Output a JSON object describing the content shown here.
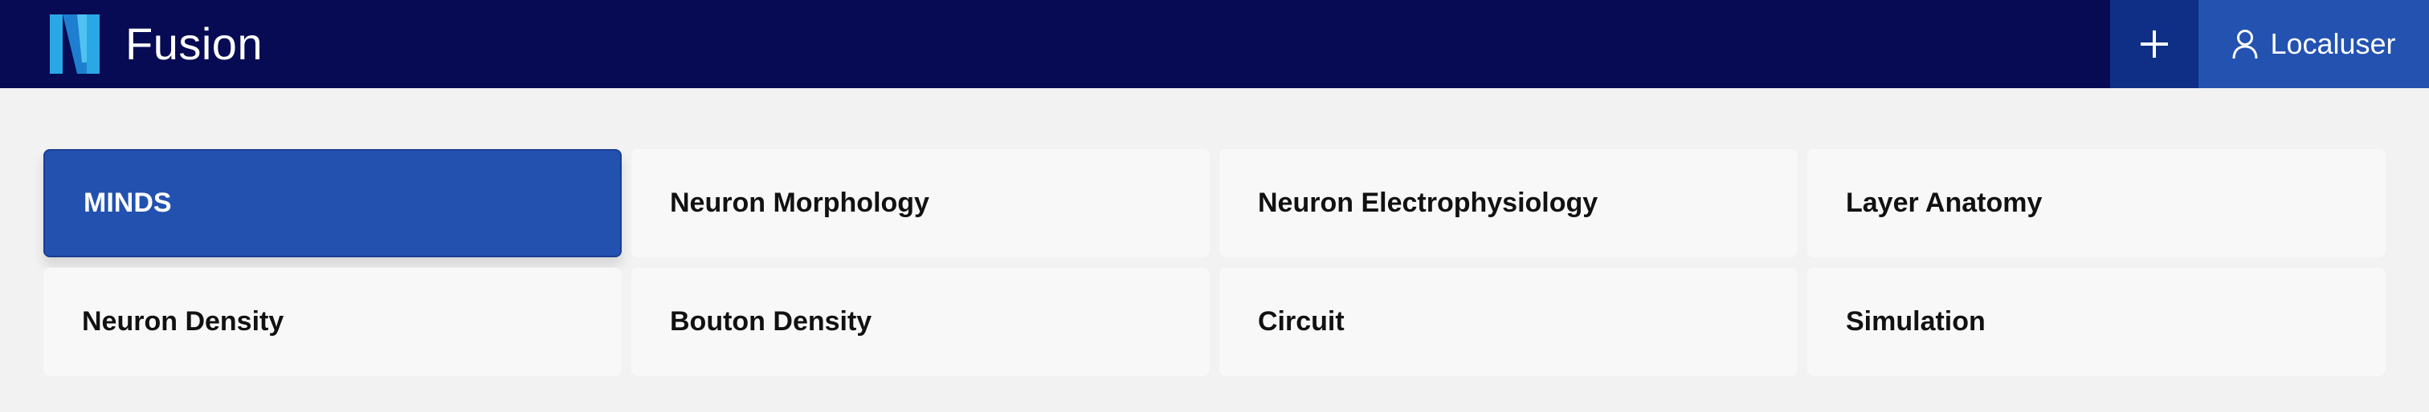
{
  "app": {
    "title": "Fusion",
    "logo_icon": "fusion-n-logo"
  },
  "header": {
    "add_icon": "plus-icon",
    "user_icon": "user-icon",
    "user_label": "Localuser"
  },
  "tiles": [
    {
      "label": "MINDS",
      "active": true
    },
    {
      "label": "Neuron Morphology",
      "active": false
    },
    {
      "label": "Neuron Electrophysiology",
      "active": false
    },
    {
      "label": "Layer Anatomy",
      "active": false
    },
    {
      "label": "Neuron Density",
      "active": false
    },
    {
      "label": "Bouton Density",
      "active": false
    },
    {
      "label": "Circuit",
      "active": false
    },
    {
      "label": "Simulation",
      "active": false
    }
  ],
  "colors": {
    "topbar": "#060b54",
    "accent": "#2251b0",
    "add_button": "#0e2f85",
    "background": "#f2f2f2",
    "tile": "#f8f8f8"
  }
}
